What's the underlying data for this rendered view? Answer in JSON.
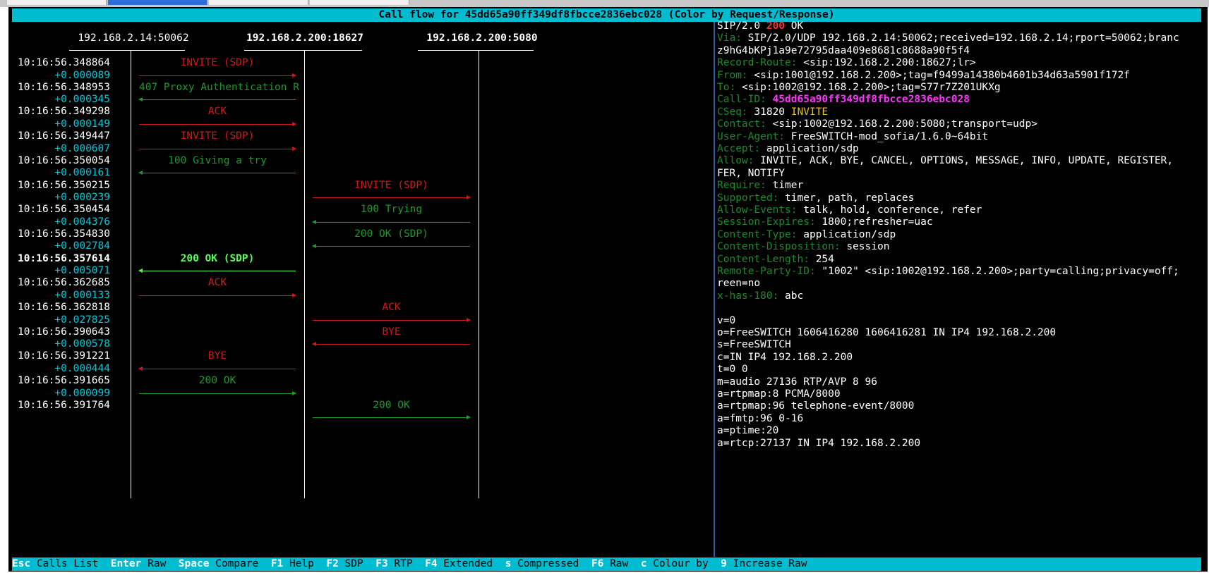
{
  "window": {
    "title": "Call flow for 45dd65a90ff349df8fbcce2836ebc028 (Color by Request/Response)"
  },
  "hosts": [
    {
      "label": "192.168.2.14:50062",
      "bold": false
    },
    {
      "label": "192.168.2.200:18627",
      "bold": true
    },
    {
      "label": "192.168.2.200:5080",
      "bold": true
    }
  ],
  "flow": [
    {
      "time": "10:16:56.348864",
      "delta": "+0.000089",
      "label": "INVITE (SDP)",
      "color": "red",
      "from": 0,
      "to": 1
    },
    {
      "time": "10:16:56.348953",
      "delta": "+0.000345",
      "label": "407 Proxy Authentication R",
      "color": "green",
      "from": 1,
      "to": 0
    },
    {
      "time": "10:16:56.349298",
      "delta": "+0.000149",
      "label": "ACK",
      "color": "red",
      "from": 0,
      "to": 1
    },
    {
      "time": "10:16:56.349447",
      "delta": "+0.000607",
      "label": "INVITE (SDP)",
      "color": "red",
      "from": 0,
      "to": 1
    },
    {
      "time": "10:16:56.350054",
      "delta": "+0.000161",
      "label": "100 Giving a try",
      "color": "green",
      "from": 1,
      "to": 0
    },
    {
      "time": "10:16:56.350215",
      "delta": "+0.000239",
      "label": "INVITE (SDP)",
      "color": "red",
      "from": 1,
      "to": 2
    },
    {
      "time": "10:16:56.350454",
      "delta": "+0.004376",
      "label": "100 Trying",
      "color": "green",
      "from": 2,
      "to": 1
    },
    {
      "time": "10:16:56.354830",
      "delta": "+0.002784",
      "label": "200 OK (SDP)",
      "color": "green",
      "from": 2,
      "to": 1
    },
    {
      "time": "10:16:56.357614",
      "delta": "+0.005071",
      "label": "200 OK (SDP)",
      "color": "bright",
      "from": 1,
      "to": 0,
      "selected": true
    },
    {
      "time": "10:16:56.362685",
      "delta": "+0.000133",
      "label": "ACK",
      "color": "red",
      "from": 0,
      "to": 1
    },
    {
      "time": "10:16:56.362818",
      "delta": "+0.027825",
      "label": "ACK",
      "color": "red",
      "from": 1,
      "to": 2
    },
    {
      "time": "10:16:56.390643",
      "delta": "+0.000578",
      "label": "BYE",
      "color": "red",
      "from": 2,
      "to": 1
    },
    {
      "time": "10:16:56.391221",
      "delta": "+0.000444",
      "label": "BYE",
      "color": "red",
      "from": 1,
      "to": 0
    },
    {
      "time": "10:16:56.391665",
      "delta": "+0.000099",
      "label": "200 OK",
      "color": "green",
      "from": 0,
      "to": 1
    },
    {
      "time": "10:16:56.391764",
      "delta": "",
      "label": "200 OK",
      "color": "green",
      "from": 1,
      "to": 2
    }
  ],
  "message": {
    "status_proto": "SIP/2.0",
    "status_code": "200",
    "status_text": "OK",
    "lines": [
      {
        "name": "Via:",
        "value": "SIP/2.0/UDP 192.168.2.14:50062;received=192.168.2.14;rport=50062;branc"
      },
      {
        "name": "",
        "value": "z9hG4bKPj1a9e72795daa409e8681c8688a90f5f4"
      },
      {
        "name": "Record-Route:",
        "value": "<sip:192.168.2.200:18627;lr>"
      },
      {
        "name": "From:",
        "value": "<sip:1001@192.168.2.200>;tag=f9499a14380b4601b34d63a5901f172f"
      },
      {
        "name": "To:",
        "value": "<sip:1002@192.168.2.200>;tag=S77r7Z201UKXg"
      },
      {
        "name": "Call-ID:",
        "value": "45dd65a90ff349df8fbcce2836ebc028",
        "style": "callid"
      },
      {
        "name": "CSeq:",
        "value": "31820",
        "extra": "INVITE"
      },
      {
        "name": "Contact:",
        "value": "<sip:1002@192.168.2.200:5080;transport=udp>"
      },
      {
        "name": "User-Agent:",
        "value": "FreeSWITCH-mod_sofia/1.6.0~64bit"
      },
      {
        "name": "Accept:",
        "value": "application/sdp"
      },
      {
        "name": "Allow:",
        "value": "INVITE, ACK, BYE, CANCEL, OPTIONS, MESSAGE, INFO, UPDATE, REGISTER,"
      },
      {
        "name": "",
        "value": "FER, NOTIFY"
      },
      {
        "name": "Require:",
        "value": "timer"
      },
      {
        "name": "Supported:",
        "value": "timer, path, replaces"
      },
      {
        "name": "Allow-Events:",
        "value": "talk, hold, conference, refer"
      },
      {
        "name": "Session-Expires:",
        "value": "1800;refresher=uac"
      },
      {
        "name": "Content-Type:",
        "value": "application/sdp"
      },
      {
        "name": "Content-Disposition:",
        "value": "session"
      },
      {
        "name": "Content-Length:",
        "value": "254"
      },
      {
        "name": "Remote-Party-ID:",
        "value": "\"1002\" <sip:1002@192.168.2.200>;party=calling;privacy=off;"
      },
      {
        "name": "",
        "value": "reen=no"
      },
      {
        "name": "x-has-180:",
        "value": "abc"
      },
      {
        "name": "",
        "value": ""
      },
      {
        "name": "",
        "value": "v=0"
      },
      {
        "name": "",
        "value": "o=FreeSWITCH 1606416280 1606416281 IN IP4 192.168.2.200"
      },
      {
        "name": "",
        "value": "s=FreeSWITCH"
      },
      {
        "name": "",
        "value": "c=IN IP4 192.168.2.200"
      },
      {
        "name": "",
        "value": "t=0 0"
      },
      {
        "name": "",
        "value": "m=audio 27136 RTP/AVP 8 96"
      },
      {
        "name": "",
        "value": "a=rtpmap:8 PCMA/8000"
      },
      {
        "name": "",
        "value": "a=rtpmap:96 telephone-event/8000"
      },
      {
        "name": "",
        "value": "a=fmtp:96 0-16"
      },
      {
        "name": "",
        "value": "a=ptime:20"
      },
      {
        "name": "",
        "value": "a=rtcp:27137 IN IP4 192.168.2.200"
      }
    ]
  },
  "shortcuts": [
    {
      "key": "Esc",
      "action": "Calls List"
    },
    {
      "key": "Enter",
      "action": "Raw"
    },
    {
      "key": "Space",
      "action": "Compare"
    },
    {
      "key": "F1",
      "action": "Help"
    },
    {
      "key": "F2",
      "action": "SDP"
    },
    {
      "key": "F3",
      "action": "RTP"
    },
    {
      "key": "F4",
      "action": "Extended"
    },
    {
      "key": "s",
      "action": "Compressed"
    },
    {
      "key": "F6",
      "action": "Raw"
    },
    {
      "key": "c",
      "action": "Colour by"
    },
    {
      "key": "9",
      "action": "Increase Raw"
    }
  ]
}
